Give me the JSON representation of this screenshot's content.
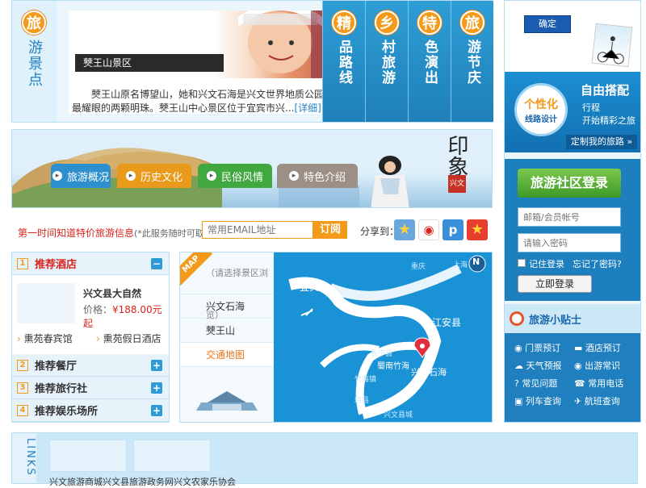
{
  "top": {
    "side_category": {
      "circle_char": "旅",
      "rest": "游景点"
    },
    "scenic": {
      "caption": "僰王山景区",
      "desc": "僰王山原名博望山，她和兴文石海是兴文世界地质公园最耀眼的两颗明珠。僰王山中心景区位于宜宾市兴...",
      "more_link": "[详细]"
    },
    "categories": [
      {
        "circle_char": "精",
        "rest": "品路线"
      },
      {
        "circle_char": "乡",
        "rest": "村旅游"
      },
      {
        "circle_char": "特",
        "rest": "色演出"
      },
      {
        "circle_char": "旅",
        "rest": "游节庆"
      }
    ]
  },
  "banner": {
    "tabs": [
      {
        "label": "旅游概况",
        "color": "#2e8fcf"
      },
      {
        "label": "历史文化",
        "color": "#e99a1a"
      },
      {
        "label": "民俗风情",
        "color": "#41a840"
      },
      {
        "label": "特色介绍",
        "color": "#9c8f86"
      }
    ],
    "calligraphy": "印象",
    "seal": "兴文"
  },
  "subscribe": {
    "lead": "第一时间知道特价旅游信息",
    "note": "(*此服务随时可取消)",
    "email_placeholder": "常用EMAIL地址",
    "button": "订阅",
    "share_label": "分享到："
  },
  "recommend": {
    "sections": [
      {
        "num": "1",
        "title": "推荐酒店",
        "toggle": "−"
      },
      {
        "num": "2",
        "title": "推荐餐厅",
        "toggle": "+"
      },
      {
        "num": "3",
        "title": "推荐旅行社",
        "toggle": "+"
      },
      {
        "num": "4",
        "title": "推荐娱乐场所",
        "toggle": "+"
      }
    ],
    "hotel": {
      "name": "兴文县大自然",
      "price_label": "价格：",
      "price": "¥188.00元起"
    },
    "links": [
      "熏苑春宾馆",
      "熏苑假日酒店"
    ]
  },
  "map": {
    "tag": "MAP",
    "hint": "（请选择景区浏览）",
    "menu": [
      "兴文石海",
      "僰王山",
      "交通地图"
    ],
    "active_index": 2,
    "labels": {
      "yibin": "宜宾",
      "jiangan": "江安县",
      "xingwen": "兴文石海",
      "north": "N",
      "chongqing": "重庆",
      "shanghai": "上海",
      "changning": "长宁县",
      "shunan": "蜀南竹海",
      "zhuhai": "竹海镇",
      "xingwenxian": "兴文县城",
      "gongxian": "珙县"
    }
  },
  "sidebar": {
    "confirm": "确定",
    "promo": {
      "badge_line1": "个性化",
      "badge_line2": "线路设计",
      "title": "自由搭配",
      "sub1": "行程",
      "sub2": "开始精彩之旅",
      "link": "定制我的旅路 »"
    },
    "login": {
      "title": "旅游社区登录",
      "user_placeholder": "邮箱/会员帐号",
      "pass_placeholder": "请输入密码",
      "remember": "记住登录",
      "forgot": "忘记了密码?",
      "button": "立即登录"
    },
    "tips": {
      "title": "旅游小贴士",
      "items": [
        "门票预订",
        "酒店预订",
        "天气预报",
        "出游常识",
        "常见问题",
        "常用电话",
        "列车查询",
        "航班查询"
      ]
    }
  },
  "links": {
    "label": "LINKS",
    "items": [
      "兴文旅游商城",
      "兴文县旅游政务网",
      "兴文农家乐协会"
    ]
  },
  "colors": {
    "primary": "#2281c4",
    "orange": "#f39a1b",
    "red": "#d9231d",
    "green": "#3fa33c"
  }
}
